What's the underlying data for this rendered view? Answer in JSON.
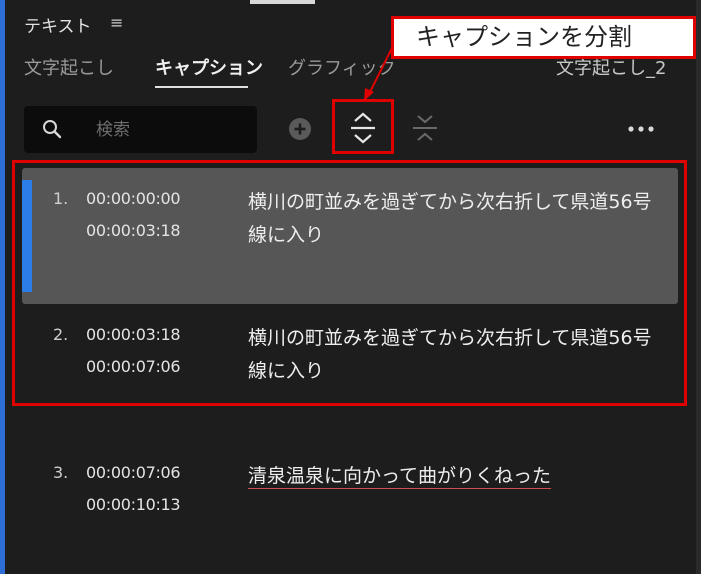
{
  "panel": {
    "title": "テキスト",
    "menu_icon": "hamburger-menu-icon"
  },
  "tabs": [
    {
      "label": "文字起こし",
      "active": false
    },
    {
      "label": "キャプション",
      "active": true
    },
    {
      "label": "グラフィック",
      "active": false
    }
  ],
  "header_right_label": "文字起こし_2",
  "search": {
    "placeholder": "検索",
    "value": ""
  },
  "toolbar": {
    "add_icon": "add-caption-icon",
    "split_icon": "split-caption-icon",
    "merge_icon": "merge-caption-icon",
    "more_icon": "more-options-icon"
  },
  "annotation": {
    "callout": "キャプションを分割",
    "color": "#e00000"
  },
  "captions": [
    {
      "num": "1.",
      "in": "00:00:00:00",
      "out": "00:00:03:18",
      "text": "横川の町並みを過ぎてから次右折して県道56号線に入り",
      "selected": true
    },
    {
      "num": "2.",
      "in": "00:00:03:18",
      "out": "00:00:07:06",
      "text": "横川の町並みを過ぎてから次右折して県道56号線に入り",
      "selected": false
    },
    {
      "num": "3.",
      "in": "00:00:07:06",
      "out": "00:00:10:13",
      "text": "清泉温泉に向かって曲がりくねった",
      "selected": false
    }
  ],
  "colors": {
    "accent": "#2b7de8",
    "selected_row": "#565656",
    "background": "#1d1d1d"
  }
}
